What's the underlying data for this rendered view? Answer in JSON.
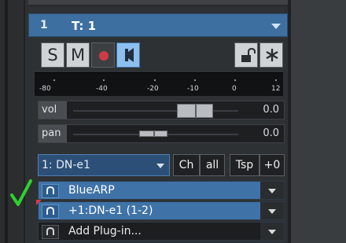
{
  "track": {
    "number": "1",
    "name": "T: 1"
  },
  "buttons": {
    "solo": "S",
    "mute": "M",
    "record_icon": "record-icon",
    "monitor_icon": "monitor-speaker-icon",
    "lock_icon": "lock-icon",
    "star_icon": "star-icon"
  },
  "meter": {
    "ticks": [
      "-80",
      "-40",
      "-20",
      "-10",
      "0",
      "12"
    ]
  },
  "params": {
    "vol_label": "vol",
    "vol_value": "0.0",
    "pan_label": "pan",
    "pan_value": "0.0"
  },
  "routing": {
    "device": "1: DN-e1",
    "channel_label": "Ch",
    "channel_value": "all",
    "transpose_label": "Tsp",
    "transpose_value": "+0"
  },
  "inserts": [
    {
      "label": "BlueARP",
      "icon": "plugin-icon"
    },
    {
      "label": "+1:DN-e1 (1-2)",
      "icon": "plugin-icon"
    },
    {
      "label": "Add Plug-in...",
      "icon": "plugin-icon"
    }
  ],
  "colors": {
    "accent_blue": "#3d6fa0",
    "record_red": "#d03a43",
    "checkmark_green": "#2fd12f"
  }
}
